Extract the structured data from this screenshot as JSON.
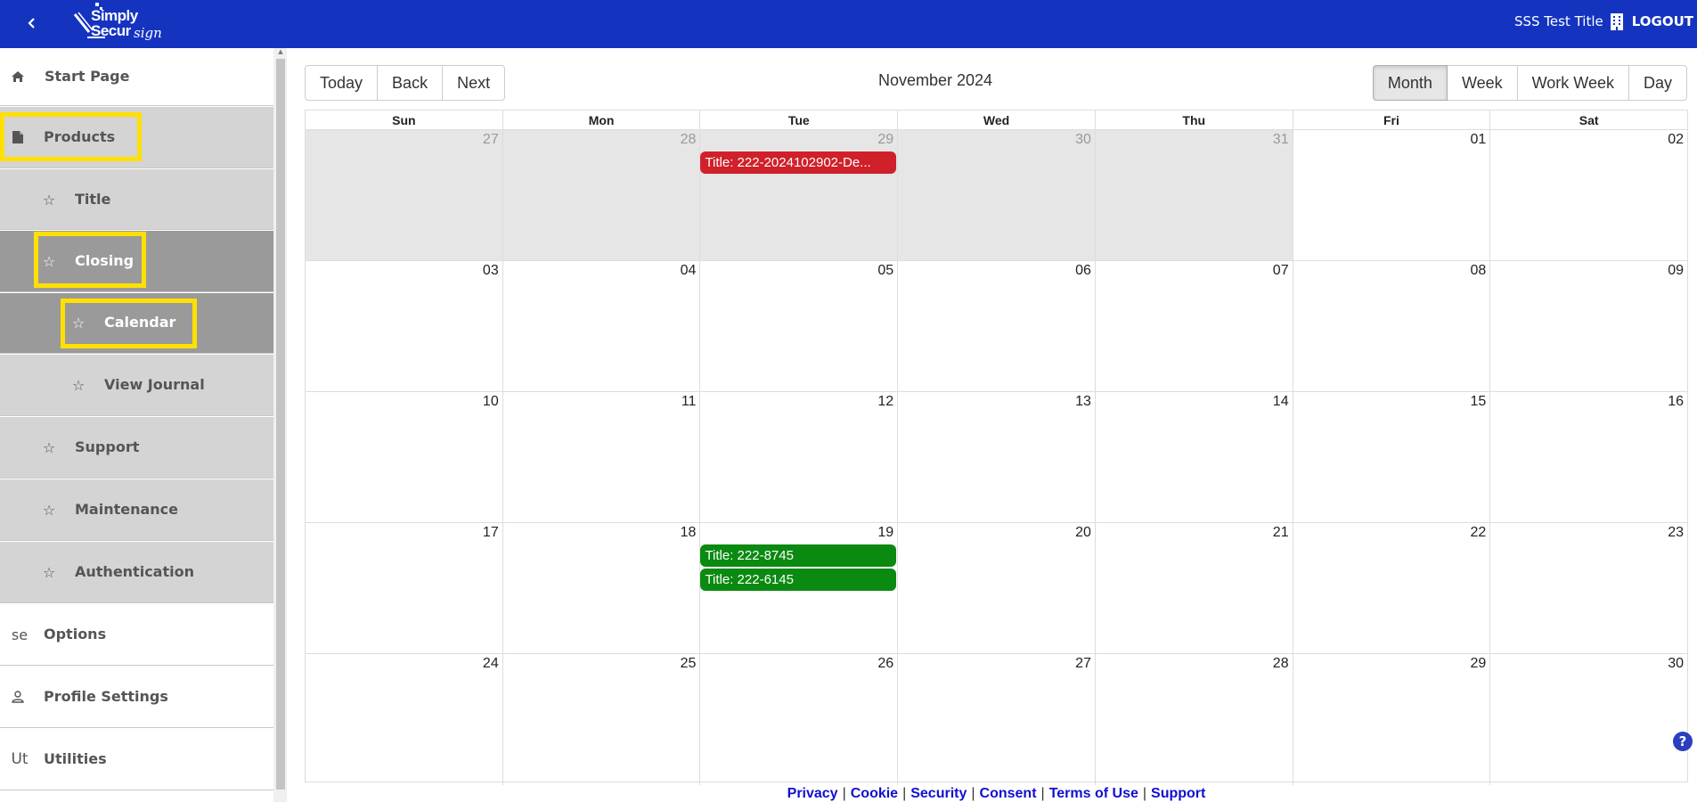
{
  "header": {
    "back_icon": "chevron-left-icon",
    "logo_line1": "Simply",
    "logo_line2": "Secur",
    "logo_line3": "sign",
    "org_name": "SSS Test Title",
    "org_icon": "building-icon",
    "logout_label": "LOGOUT",
    "bg_color": "#1434c0"
  },
  "sidebar": {
    "items": [
      {
        "label": "Start Page",
        "icon": "home-icon"
      },
      {
        "label": "Products",
        "icon": "document-icon"
      },
      {
        "label": "Title",
        "icon": "star-icon"
      },
      {
        "label": "Closing",
        "icon": "star-icon"
      },
      {
        "label": "Calendar",
        "icon": "star-icon"
      },
      {
        "label": "View Journal",
        "icon": "star-icon"
      },
      {
        "label": "Support",
        "icon": "star-icon"
      },
      {
        "label": "Maintenance",
        "icon": "star-icon"
      },
      {
        "label": "Authentication",
        "icon": "star-icon"
      },
      {
        "label": "Options",
        "icon": "se-glyph-icon",
        "glyph": "sе"
      },
      {
        "label": "Profile Settings",
        "icon": "person-icon"
      },
      {
        "label": "Utilities",
        "icon": "ut-glyph-icon",
        "glyph": "Ut"
      }
    ]
  },
  "toolbar": {
    "today": "Today",
    "back": "Back",
    "next": "Next",
    "title": "November 2024",
    "views": [
      "Month",
      "Week",
      "Work Week",
      "Day"
    ],
    "active_view": "Month"
  },
  "calendar": {
    "dow": [
      "Sun",
      "Mon",
      "Tue",
      "Wed",
      "Thu",
      "Fri",
      "Sat"
    ],
    "weeks": [
      [
        "27",
        "28",
        "29",
        "30",
        "31",
        "01",
        "02"
      ],
      [
        "03",
        "04",
        "05",
        "06",
        "07",
        "08",
        "09"
      ],
      [
        "10",
        "11",
        "12",
        "13",
        "14",
        "15",
        "16"
      ],
      [
        "17",
        "18",
        "19",
        "20",
        "21",
        "22",
        "23"
      ],
      [
        "24",
        "25",
        "26",
        "27",
        "28",
        "29",
        "30"
      ]
    ],
    "events": {
      "e1": "Title: 222-2024102902-De...",
      "e2": "Title: 222-8745",
      "e3": "Title: 222-6145"
    },
    "event_colors": {
      "red": "#d0202a",
      "green": "#0a8a10"
    }
  },
  "footer": {
    "links": [
      "Privacy",
      "Cookie",
      "Security",
      "Consent",
      "Terms of Use",
      "Support"
    ]
  },
  "help": "?"
}
